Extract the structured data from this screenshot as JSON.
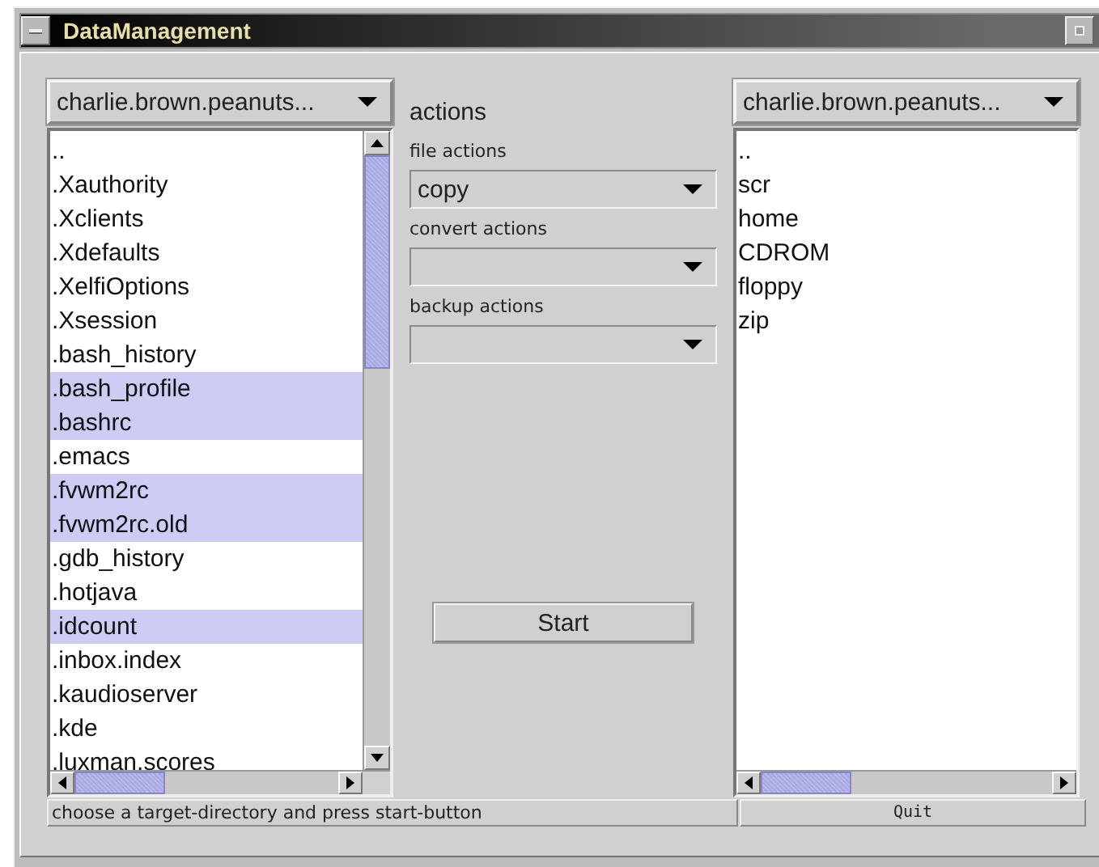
{
  "window": {
    "title": "DataManagement"
  },
  "source": {
    "directory": "charlie.brown.peanuts...",
    "items": [
      {
        "name": "..",
        "selected": false
      },
      {
        "name": ".Xauthority",
        "selected": false
      },
      {
        "name": ".Xclients",
        "selected": false
      },
      {
        "name": ".Xdefaults",
        "selected": false
      },
      {
        "name": ".XelfiOptions",
        "selected": false
      },
      {
        "name": ".Xsession",
        "selected": false
      },
      {
        "name": ".bash_history",
        "selected": false
      },
      {
        "name": ".bash_profile",
        "selected": true
      },
      {
        "name": ".bashrc",
        "selected": true
      },
      {
        "name": ".emacs",
        "selected": false
      },
      {
        "name": ".fvwm2rc",
        "selected": true
      },
      {
        "name": ".fvwm2rc.old",
        "selected": true
      },
      {
        "name": ".gdb_history",
        "selected": false
      },
      {
        "name": ".hotjava",
        "selected": false
      },
      {
        "name": ".idcount",
        "selected": true
      },
      {
        "name": ".inbox.index",
        "selected": false
      },
      {
        "name": ".kaudioserver",
        "selected": false
      },
      {
        "name": ".kde",
        "selected": false
      },
      {
        "name": ".luxman.scores",
        "selected": false
      }
    ]
  },
  "actions": {
    "heading": "actions",
    "groups": [
      {
        "label": "file actions",
        "value": "copy"
      },
      {
        "label": "convert actions"
      },
      {
        "label": "backup actions"
      }
    ],
    "start_button": "Start"
  },
  "target": {
    "directory": "charlie.brown.peanuts...",
    "items": [
      "..",
      "scr",
      "home",
      "CDROM",
      "floppy",
      "zip"
    ]
  },
  "status_bar": "choose a target-directory and press start-button",
  "quit_button": "Quit"
}
